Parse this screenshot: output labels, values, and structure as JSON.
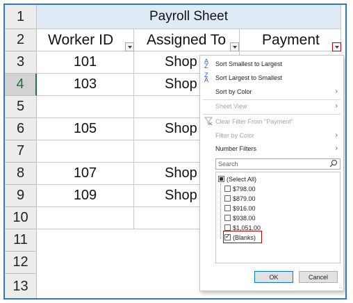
{
  "sheet": {
    "row_numbers": [
      "1",
      "2",
      "3",
      "4",
      "5",
      "6",
      "7",
      "8",
      "9",
      "10",
      "11",
      "12",
      "13"
    ],
    "active_row": "4",
    "title": "Payroll Sheet",
    "headers": {
      "worker_id": "Worker ID",
      "assigned_to": "Assigned To",
      "payment": "Payment"
    },
    "rows": [
      {
        "worker_id": "101",
        "assigned_to": "Shop"
      },
      {
        "worker_id": "103",
        "assigned_to": "Shop"
      },
      {
        "worker_id": "",
        "assigned_to": ""
      },
      {
        "worker_id": "105",
        "assigned_to": "Shop"
      },
      {
        "worker_id": "",
        "assigned_to": ""
      },
      {
        "worker_id": "107",
        "assigned_to": "Shop"
      },
      {
        "worker_id": "109",
        "assigned_to": "Shop"
      },
      {
        "worker_id": "",
        "assigned_to": ""
      }
    ]
  },
  "filter_menu": {
    "sort_asc": "Sort Smallest to Largest",
    "sort_desc": "Sort Largest to Smallest",
    "sort_color": "Sort by Color",
    "sheet_view": "Sheet View",
    "clear_filter": "Clear Filter From \"Payment\"",
    "filter_color": "Filter by Color",
    "number_filters": "Number Filters",
    "search_placeholder": "Search",
    "items": [
      {
        "label": "(Select All)",
        "state": "partial"
      },
      {
        "label": "$798.00",
        "state": "unchecked"
      },
      {
        "label": "$879.00",
        "state": "unchecked"
      },
      {
        "label": "$916.00",
        "state": "unchecked"
      },
      {
        "label": "$938.00",
        "state": "unchecked"
      },
      {
        "label": "$1,051.00",
        "state": "unchecked"
      },
      {
        "label": "(Blanks)",
        "state": "checked"
      }
    ],
    "ok_label": "OK",
    "cancel_label": "Cancel",
    "highlight_color": "#c00000"
  }
}
